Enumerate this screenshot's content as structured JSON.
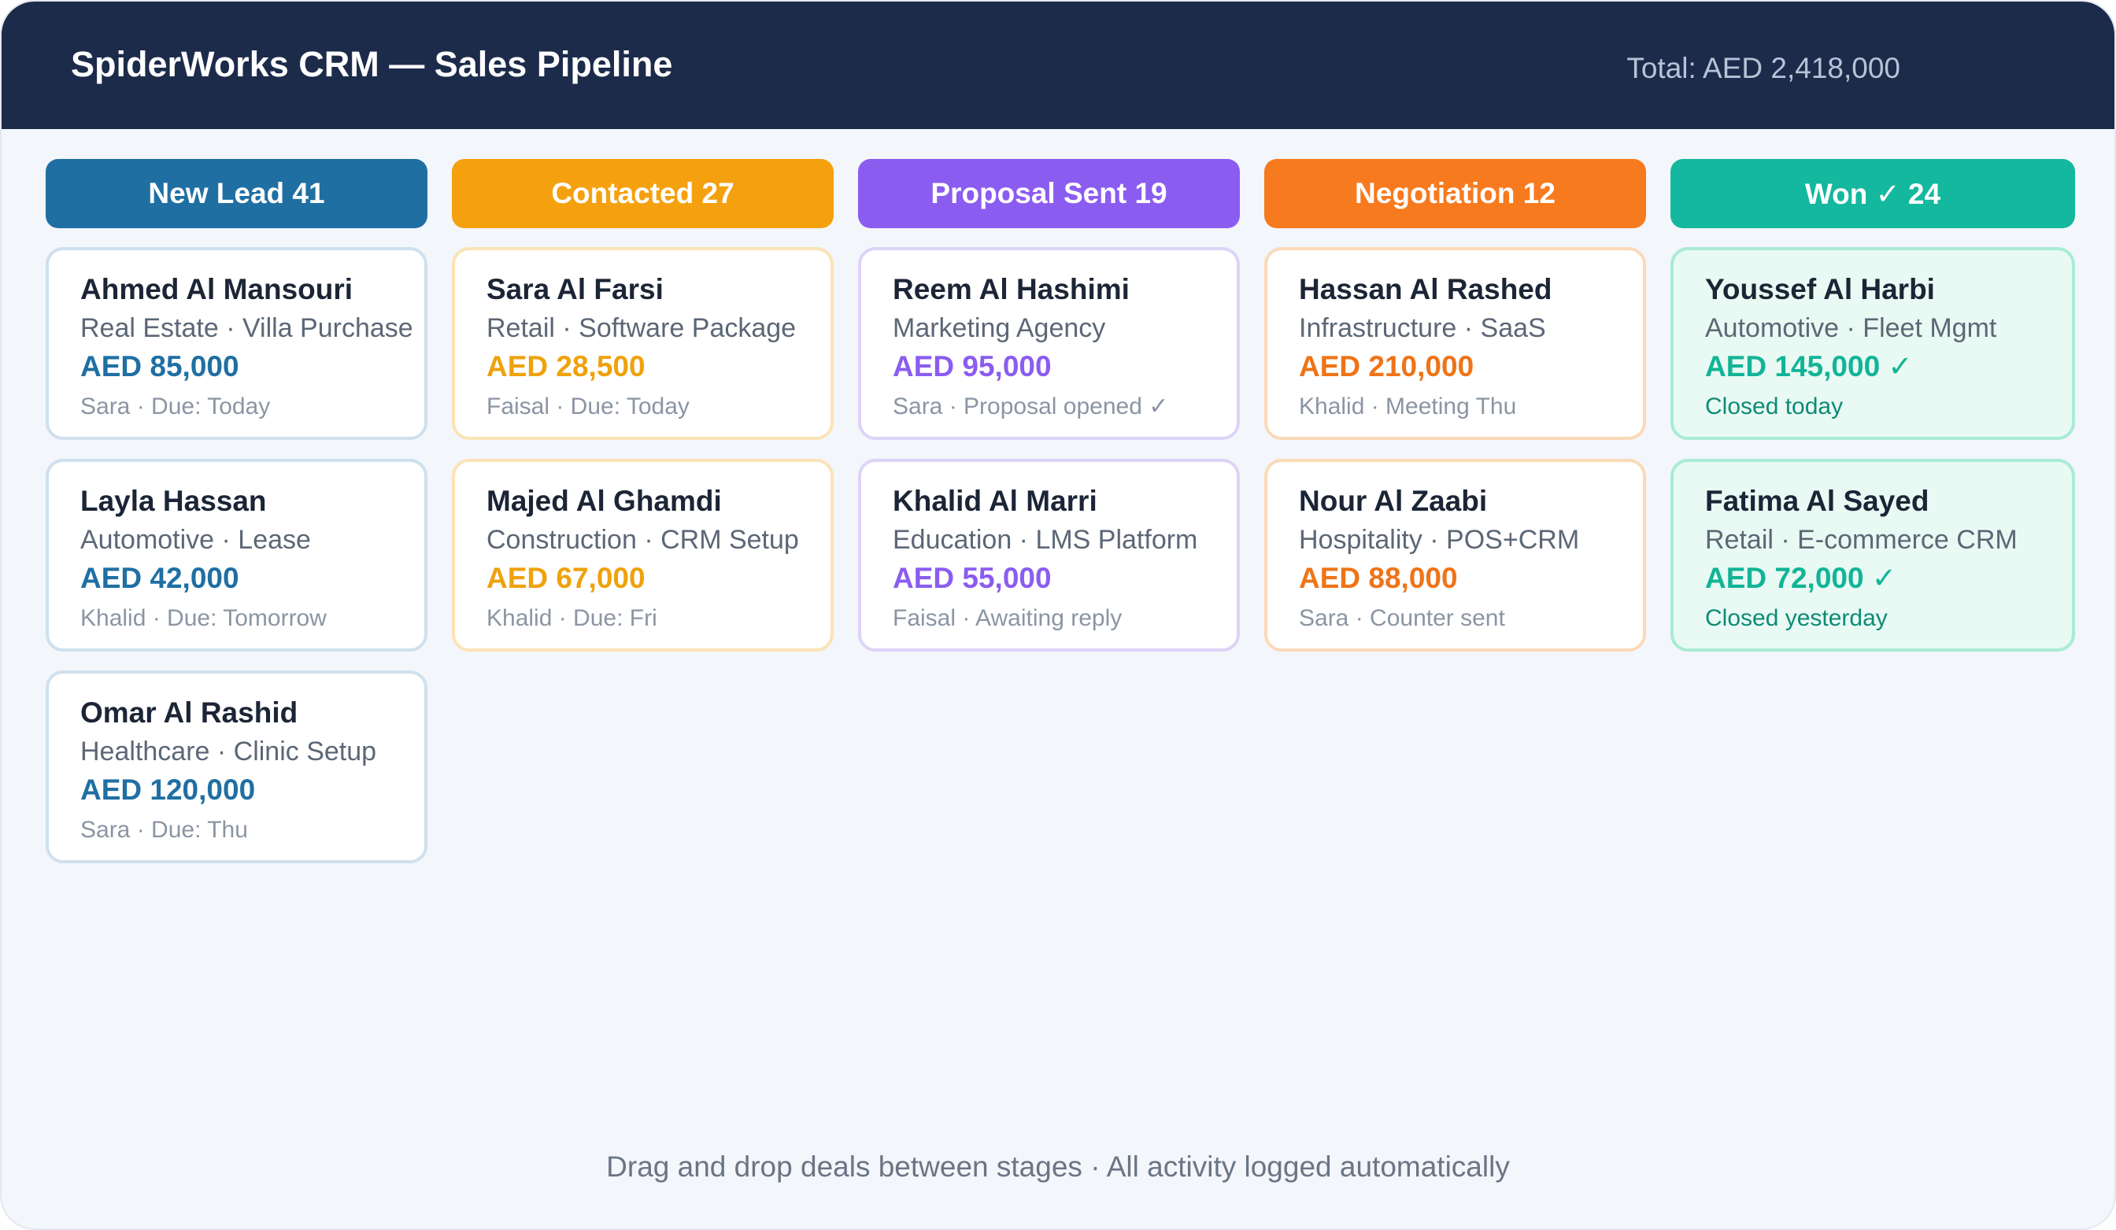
{
  "app": {
    "title": "SpiderWorks CRM — Sales Pipeline",
    "total": "Total: AED 2,418,000"
  },
  "colors": {
    "header_bg": "#1d2b4b",
    "new_lead": "#1f6fa3",
    "contacted": "#f5a10f",
    "proposal_sent": "#8b5cf0",
    "negotiation": "#f77a1e",
    "won": "#14b89e"
  },
  "columns": [
    {
      "header": "New Lead 41",
      "color": "#1f6fa3",
      "card_border": "#cfe0ee",
      "card_bg": "#ffffff",
      "amount_color": "#1f6fa3",
      "meta_color": "#8b95a3",
      "cards": [
        {
          "name": "Ahmed Al Mansouri",
          "sub": "Real Estate · Villa Purchase",
          "amount": "AED 85,000",
          "meta": "Sara · Due: Today"
        },
        {
          "name": "Layla Hassan",
          "sub": "Automotive · Lease",
          "amount": "AED 42,000",
          "meta": "Khalid · Due: Tomorrow"
        },
        {
          "name": "Omar Al Rashid",
          "sub": "Healthcare · Clinic Setup",
          "amount": "AED 120,000",
          "meta": "Sara · Due: Thu"
        }
      ]
    },
    {
      "header": "Contacted 27",
      "color": "#f5a10f",
      "card_border": "#fbe3b6",
      "card_bg": "#ffffff",
      "amount_color": "#eea20c",
      "meta_color": "#8b95a3",
      "cards": [
        {
          "name": "Sara Al Farsi",
          "sub": "Retail · Software Package",
          "amount": "AED 28,500",
          "meta": "Faisal · Due: Today"
        },
        {
          "name": "Majed Al Ghamdi",
          "sub": "Construction · CRM Setup",
          "amount": "AED 67,000",
          "meta": "Khalid · Due: Fri"
        }
      ]
    },
    {
      "header": "Proposal Sent 19",
      "color": "#8b5cf0",
      "card_border": "#ddd3f8",
      "card_bg": "#ffffff",
      "amount_color": "#8b5cf0",
      "meta_color": "#8b95a3",
      "cards": [
        {
          "name": "Reem Al Hashimi",
          "sub": "Marketing Agency",
          "amount": "AED 95,000",
          "meta": "Sara · Proposal opened ✓"
        },
        {
          "name": "Khalid Al Marri",
          "sub": "Education · LMS Platform",
          "amount": "AED 55,000",
          "meta": "Faisal · Awaiting reply"
        }
      ]
    },
    {
      "header": "Negotiation 12",
      "color": "#f77a1e",
      "card_border": "#fbd9b8",
      "card_bg": "#ffffff",
      "amount_color": "#ef7418",
      "meta_color": "#8b95a3",
      "cards": [
        {
          "name": "Hassan Al Rashed",
          "sub": "Infrastructure · SaaS",
          "amount": "AED 210,000",
          "meta": "Khalid · Meeting Thu"
        },
        {
          "name": "Nour Al Zaabi",
          "sub": "Hospitality · POS+CRM",
          "amount": "AED 88,000",
          "meta": "Sara · Counter sent"
        }
      ]
    },
    {
      "header": "Won ✓ 24",
      "color": "#14b89e",
      "card_border": "#a9ebd6",
      "card_bg": "#e8faf3",
      "amount_color": "#12b497",
      "meta_color": "#0f8a76",
      "cards": [
        {
          "name": "Youssef Al Harbi",
          "sub": "Automotive · Fleet Mgmt",
          "amount": "AED 145,000 ✓",
          "meta": "Closed today"
        },
        {
          "name": "Fatima Al Sayed",
          "sub": "Retail · E-commerce CRM",
          "amount": "AED 72,000 ✓",
          "meta": "Closed yesterday"
        }
      ]
    }
  ],
  "footer": "Drag and drop deals between stages · All activity logged automatically"
}
